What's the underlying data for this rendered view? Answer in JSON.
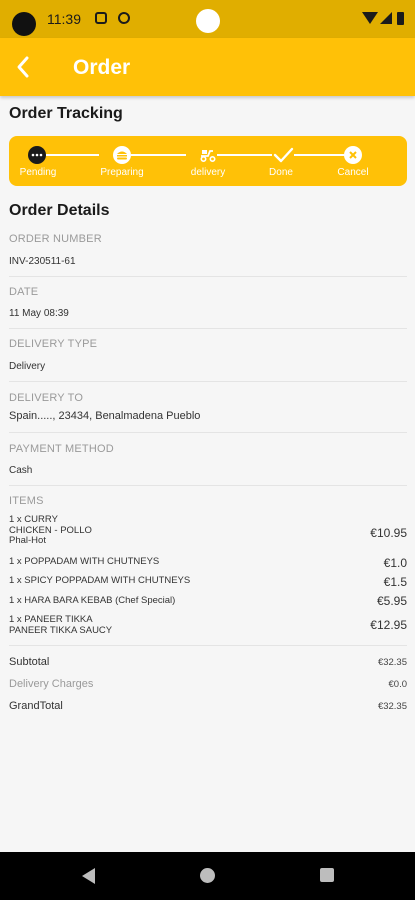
{
  "status": {
    "time": "11:39"
  },
  "header": {
    "title": "Order"
  },
  "tracking": {
    "title": "Order Tracking",
    "steps": [
      {
        "label": "Pending",
        "icon": "dots-icon",
        "active": true
      },
      {
        "label": "Preparing",
        "icon": "burger-icon",
        "active": false
      },
      {
        "label": "delivery",
        "icon": "scooter-icon",
        "active": false
      },
      {
        "label": "Done",
        "icon": "check-icon",
        "active": false
      },
      {
        "label": "Cancel",
        "icon": "close-icon",
        "active": false
      }
    ]
  },
  "details": {
    "title": "Order Details",
    "order_number_label": "ORDER NUMBER",
    "order_number": "INV-230511-61",
    "date_label": "DATE",
    "date": "11 May 08:39",
    "delivery_type_label": "DELIVERY TYPE",
    "delivery_type": "Delivery",
    "delivery_to_label": "DELIVERY TO",
    "delivery_to": "Spain....., 23434, Benalmadena Pueblo",
    "payment_method_label": "PAYMENT METHOD",
    "payment_method": "Cash",
    "items_label": "ITEMS",
    "items": [
      {
        "lines": [
          "1 x CURRY",
          "CHICKEN - POLLO",
          "Phal-Hot"
        ],
        "price": "€10.95"
      },
      {
        "lines": [
          "1 x POPPADAM WITH CHUTNEYS"
        ],
        "price": "€1.0"
      },
      {
        "lines": [
          "1 x SPICY POPPADAM WITH CHUTNEYS"
        ],
        "price": "€1.5"
      },
      {
        "lines": [
          "1 x HARA BARA KEBAB (Chef Special)"
        ],
        "price": "€5.95"
      },
      {
        "lines": [
          "1 x PANEER TIKKA",
          "PANEER TIKKA SAUCY"
        ],
        "price": "€12.95"
      }
    ]
  },
  "summary": {
    "subtotal_label": "Subtotal",
    "subtotal": "€32.35",
    "delivery_label": "Delivery Charges",
    "delivery": "€0.0",
    "grand_label": "GrandTotal",
    "grand": "€32.35"
  },
  "colors": {
    "accent": "#ffc107",
    "status_bar": "#e0ae00",
    "background": "#f6f6f6"
  }
}
